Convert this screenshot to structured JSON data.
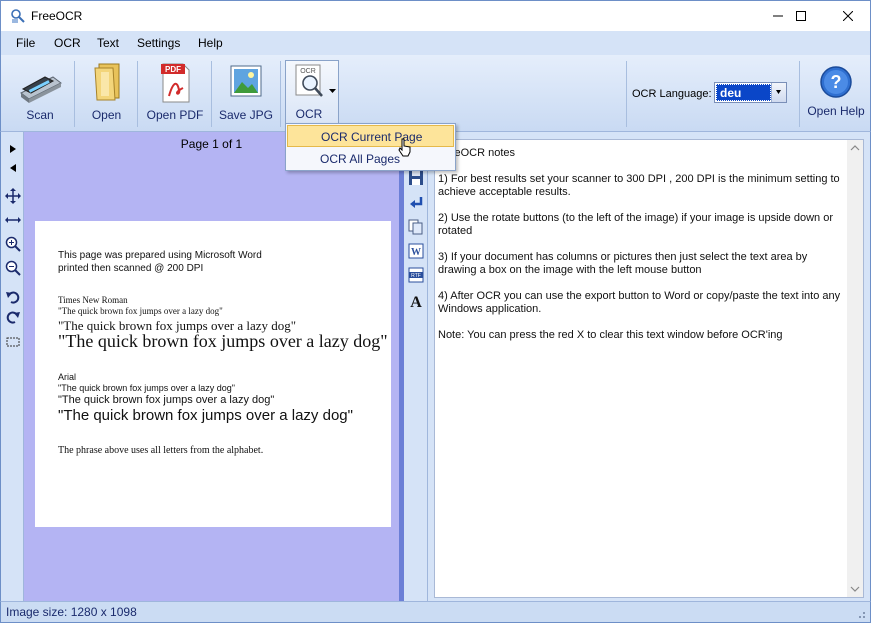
{
  "window": {
    "title": "FreeOCR",
    "minimize_icon": "minimize-icon",
    "maximize_icon": "maximize-icon",
    "close_icon": "close-icon"
  },
  "menu": [
    "File",
    "OCR",
    "Text",
    "Settings",
    "Help"
  ],
  "toolbar": {
    "scan_label": "Scan",
    "open_label": "Open",
    "open_pdf_label": "Open PDF",
    "pdf_badge": "PDF",
    "save_jpg_label": "Save JPG",
    "ocr_label": "OCR",
    "ocr_badge": "OCR",
    "language_label": "OCR Language:",
    "language_value": "deu",
    "open_help_label": "Open Help"
  },
  "ocr_menu": {
    "items": [
      "OCR Current Page",
      "OCR All Pages"
    ],
    "highlighted": "OCR Current Page"
  },
  "image_pane": {
    "page_label": "Page 1 of 1",
    "document_lines": [
      "This page was prepared using Microsoft Word",
      "printed then scanned @ 200 DPI",
      "Times New Roman",
      "\"The quick brown fox jumps over a lazy dog\"",
      "\"The quick brown fox jumps over a lazy dog\"",
      "\"The quick brown fox jumps over a lazy dog\"",
      "Arial",
      "\"The quick brown fox jumps over a lazy dog\"",
      "\"The quick brown fox  jumps over a lazy dog\"",
      "\"The quick brown fox jumps over a lazy dog\"",
      "The phrase above uses all letters from the alphabet."
    ]
  },
  "text_pane": {
    "notes": [
      "FreeOCR notes",
      "1) For best results set your scanner to 300 DPI , 200 DPI is the minimum setting to achieve acceptable results.",
      "2) Use the rotate buttons (to the left of the image) if your image is upside down or rotated",
      "3) If your document has columns or pictures then just select the text area by drawing a box on the image with the left mouse button",
      "4) After OCR you can use the export button to Word or copy/paste the text into any Windows application.",
      "Note: You can press the red X to clear this text window before OCR'ing"
    ]
  },
  "status": {
    "image_size": "Image size:  1280 x  1098"
  }
}
